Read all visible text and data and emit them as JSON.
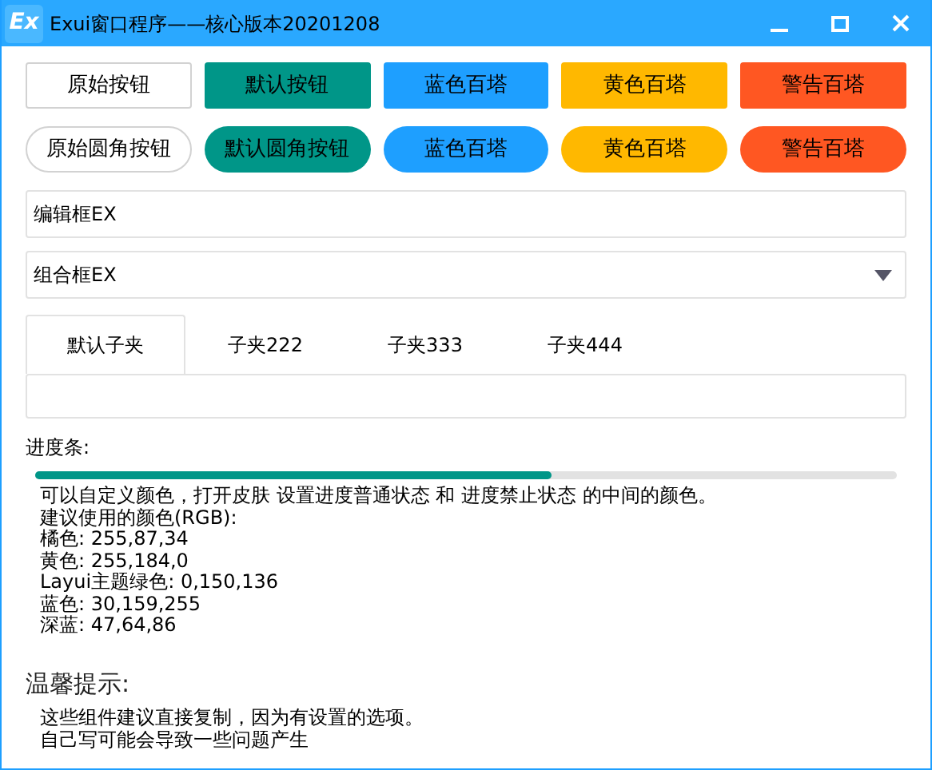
{
  "window": {
    "title": "Exui窗口程序——核心版本20201208",
    "logo": "Ex"
  },
  "button_rows": [
    {
      "rounded": false,
      "buttons": [
        {
          "label": "原始按钮",
          "color": "#ffffff"
        },
        {
          "label": "默认按钮",
          "color": "#009688"
        },
        {
          "label": "蓝色百塔",
          "color": "#1e9fff"
        },
        {
          "label": "黄色百塔",
          "color": "#ffb800"
        },
        {
          "label": "警告百塔",
          "color": "#ff5722"
        }
      ]
    },
    {
      "rounded": true,
      "buttons": [
        {
          "label": "原始圆角按钮",
          "color": "#ffffff"
        },
        {
          "label": "默认圆角按钮",
          "color": "#009688"
        },
        {
          "label": "蓝色百塔",
          "color": "#1e9fff"
        },
        {
          "label": "黄色百塔",
          "color": "#ffb800"
        },
        {
          "label": "警告百塔",
          "color": "#ff5722"
        }
      ]
    }
  ],
  "edit_box": {
    "value": "编辑框EX"
  },
  "combo_box": {
    "value": "组合框EX"
  },
  "tabs": [
    {
      "label": "默认子夹",
      "selected": true
    },
    {
      "label": "子夹222",
      "selected": false
    },
    {
      "label": "子夹333",
      "selected": false
    },
    {
      "label": "子夹444",
      "selected": false
    }
  ],
  "progress": {
    "label": "进度条:",
    "level": 0.6
  },
  "description": [
    "可以自定义颜色，打开皮肤  设置进度普通状态  和  进度禁止状态  的中间的颜色。",
    "建议使用的颜色(RGB):",
    "橘色: 255,87,34",
    "黄色: 255,184,0",
    "Layui主题绿色: 0,150,136",
    "蓝色: 30,159,255",
    "深蓝: 47,64,86"
  ],
  "tip": {
    "heading": "温馨提示:",
    "lines": [
      "这些组件建议直接复制，因为有设置的选项。",
      "自己写可能会导致一些问题产生"
    ]
  }
}
